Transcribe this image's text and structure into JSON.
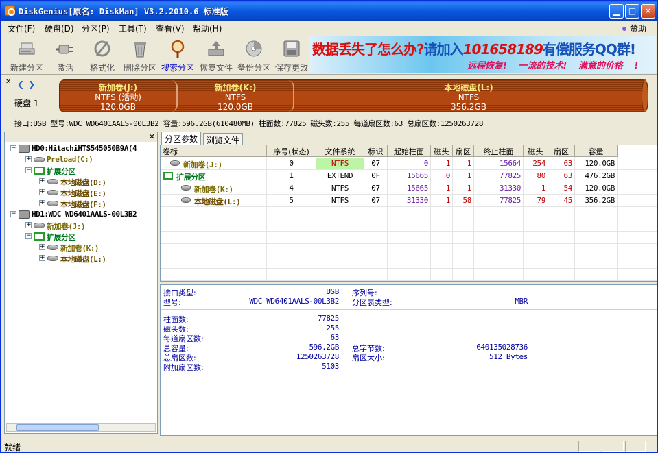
{
  "window": {
    "title": "DiskGenius[原名: DiskMan] V3.2.2010.6 标准版"
  },
  "menu": {
    "items": [
      "文件(F)",
      "硬盘(D)",
      "分区(P)",
      "工具(T)",
      "查看(V)",
      "帮助(H)"
    ],
    "sponsor": "赞助"
  },
  "toolbar": {
    "buttons": [
      {
        "label": "新建分区",
        "icon": "new-partition-icon"
      },
      {
        "label": "激活",
        "icon": "activate-plug-icon"
      },
      {
        "label": "格式化",
        "icon": "format-icon"
      },
      {
        "label": "删除分区",
        "icon": "delete-trash-icon"
      },
      {
        "label": "搜索分区",
        "icon": "search-magnifier-icon",
        "active": true
      },
      {
        "label": "恢复文件",
        "icon": "recover-file-icon"
      },
      {
        "label": "备份分区",
        "icon": "backup-disc-icon"
      },
      {
        "label": "保存更改",
        "icon": "save-changes-icon"
      }
    ]
  },
  "banner": {
    "line1_a": "数据丢失了怎么办?",
    "line1_b": "请加入",
    "line1_num": "101658189",
    "line1_c": "有偿服务QQ群!",
    "line2": "远程恢复! 一流的技术! 满意的价格 !"
  },
  "diskmap": {
    "disk_label": "硬盘 1",
    "partitions": [
      {
        "name": "新加卷(J:)",
        "fs": "NTFS (活动)",
        "size": "120.0GB"
      },
      {
        "name": "新加卷(K:)",
        "fs": "NTFS",
        "size": "120.0GB"
      },
      {
        "name": "本地磁盘(L:)",
        "fs": "NTFS",
        "size": "356.2GB"
      }
    ],
    "info": "接口:USB  型号:WDC WD6401AALS-00L3B2  容量:596.2GB(610480MB)  柱面数:77825  磁头数:255  每道扇区数:63  总扇区数:1250263728"
  },
  "tree": {
    "nodes": [
      {
        "label": "HD0:HitachiHTS545050B9A(4",
        "kind": "disk",
        "exp": "-"
      },
      {
        "label": "Preload(C:)",
        "kind": "part",
        "exp": "+",
        "color": "olive"
      },
      {
        "label": "扩展分区",
        "kind": "ext",
        "exp": "-",
        "color": "green"
      },
      {
        "label": "本地磁盘(D:)",
        "kind": "part",
        "exp": "+",
        "color": "brown"
      },
      {
        "label": "本地磁盘(E:)",
        "kind": "part",
        "exp": "+",
        "color": "brown"
      },
      {
        "label": "本地磁盘(F:)",
        "kind": "part",
        "exp": "+",
        "color": "brown"
      },
      {
        "label": "HD1:WDC WD6401AALS-00L3B2",
        "kind": "disk",
        "exp": "-"
      },
      {
        "label": "新加卷(J:)",
        "kind": "part",
        "exp": "+",
        "color": "olive"
      },
      {
        "label": "扩展分区",
        "kind": "ext",
        "exp": "-",
        "color": "green"
      },
      {
        "label": "新加卷(K:)",
        "kind": "part",
        "exp": "+",
        "color": "olive"
      },
      {
        "label": "本地磁盘(L:)",
        "kind": "part",
        "exp": "+",
        "color": "brown"
      }
    ]
  },
  "tabs": [
    "分区参数",
    "浏览文件"
  ],
  "grid": {
    "headers": [
      "卷标",
      "序号(状态)",
      "文件系统",
      "标识",
      "起始柱面",
      "磁头",
      "扇区",
      "终止柱面",
      "磁头",
      "扇区",
      "容量"
    ],
    "rows": [
      {
        "label": "新加卷(J:)",
        "kind": "part",
        "color": "olive",
        "cells": [
          "0",
          "NTFS",
          "07",
          "0",
          "1",
          "1",
          "15664",
          "254",
          "63",
          "120.0GB"
        ]
      },
      {
        "label": "扩展分区",
        "kind": "ext",
        "color": "green",
        "cells": [
          "1",
          "EXTEND",
          "0F",
          "15665",
          "0",
          "1",
          "77825",
          "80",
          "63",
          "476.2GB"
        ]
      },
      {
        "label": "新加卷(K:)",
        "kind": "part",
        "color": "olive",
        "cells": [
          "4",
          "NTFS",
          "07",
          "15665",
          "1",
          "1",
          "31330",
          "1",
          "54",
          "120.0GB"
        ]
      },
      {
        "label": "本地磁盘(L:)",
        "kind": "part",
        "color": "brown",
        "cells": [
          "5",
          "NTFS",
          "07",
          "31330",
          "1",
          "58",
          "77825",
          "79",
          "45",
          "356.2GB"
        ]
      }
    ]
  },
  "details": {
    "interface_label": "接口类型:",
    "interface_value": "USB",
    "serial_label": "序列号:",
    "model_label": "型号:",
    "model_value": "WDC WD6401AALS-00L3B2",
    "pt_label": "分区表类型:",
    "pt_value": "MBR",
    "cyl_label": "柱面数:",
    "cyl_value": "77825",
    "heads_label": "磁头数:",
    "heads_value": "255",
    "spt_label": "每道扇区数:",
    "spt_value": "63",
    "cap_label": "总容量:",
    "cap_value": "596.2GB",
    "bytes_label": "总字节数:",
    "bytes_value": "640135028736",
    "sectors_label": "总扇区数:",
    "sectors_value": "1250263728",
    "secsize_label": "扇区大小:",
    "secsize_value": "512 Bytes",
    "extra_label": "附加扇区数:",
    "extra_value": "5103"
  },
  "status": {
    "text": "就绪"
  }
}
